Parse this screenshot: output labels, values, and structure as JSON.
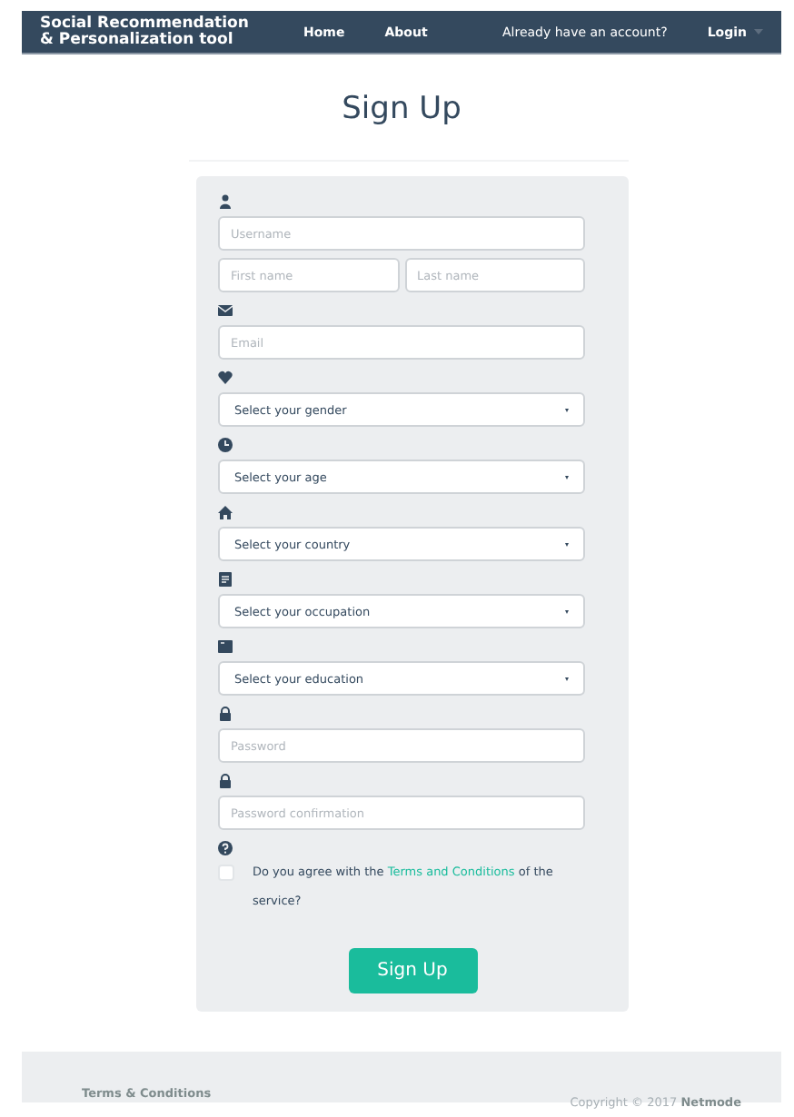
{
  "navbar": {
    "brand": "Social Recommendation & Personalization tool",
    "links": [
      {
        "label": "Home"
      },
      {
        "label": "About"
      }
    ],
    "account_prompt": "Already have an account?",
    "login": "Login"
  },
  "heading": "Sign Up",
  "form": {
    "groups": [
      {
        "fields": [
          {
            "kind": "text",
            "placeholder": "Username"
          },
          {
            "kind": "pair",
            "parts": [
              {
                "placeholder": "First name"
              },
              {
                "placeholder": "Last name"
              }
            ]
          }
        ]
      },
      {
        "fields": [
          {
            "kind": "text",
            "placeholder": "Email"
          }
        ]
      },
      {
        "fields": [
          {
            "kind": "select",
            "value": "Select your gender"
          }
        ]
      },
      {
        "fields": [
          {
            "kind": "select",
            "value": "Select your age"
          }
        ]
      },
      {
        "fields": [
          {
            "kind": "select",
            "value": "Select your country"
          }
        ]
      },
      {
        "fields": [
          {
            "kind": "select",
            "value": "Select your occupation"
          }
        ]
      },
      {
        "fields": [
          {
            "kind": "select",
            "value": "Select your education"
          }
        ]
      },
      {
        "fields": [
          {
            "kind": "text",
            "placeholder": "Password"
          }
        ]
      },
      {
        "fields": [
          {
            "kind": "text",
            "placeholder": "Password confirmation"
          }
        ]
      }
    ],
    "agreement": {
      "checked": false,
      "prefix": "Do you agree with the",
      "link": "Terms and Conditions",
      "suffix": "of the service?"
    },
    "submit": "Sign Up"
  },
  "footer": {
    "link": "Terms & Conditions",
    "copyright": "Copyright © 2017",
    "company": "Netmode"
  }
}
